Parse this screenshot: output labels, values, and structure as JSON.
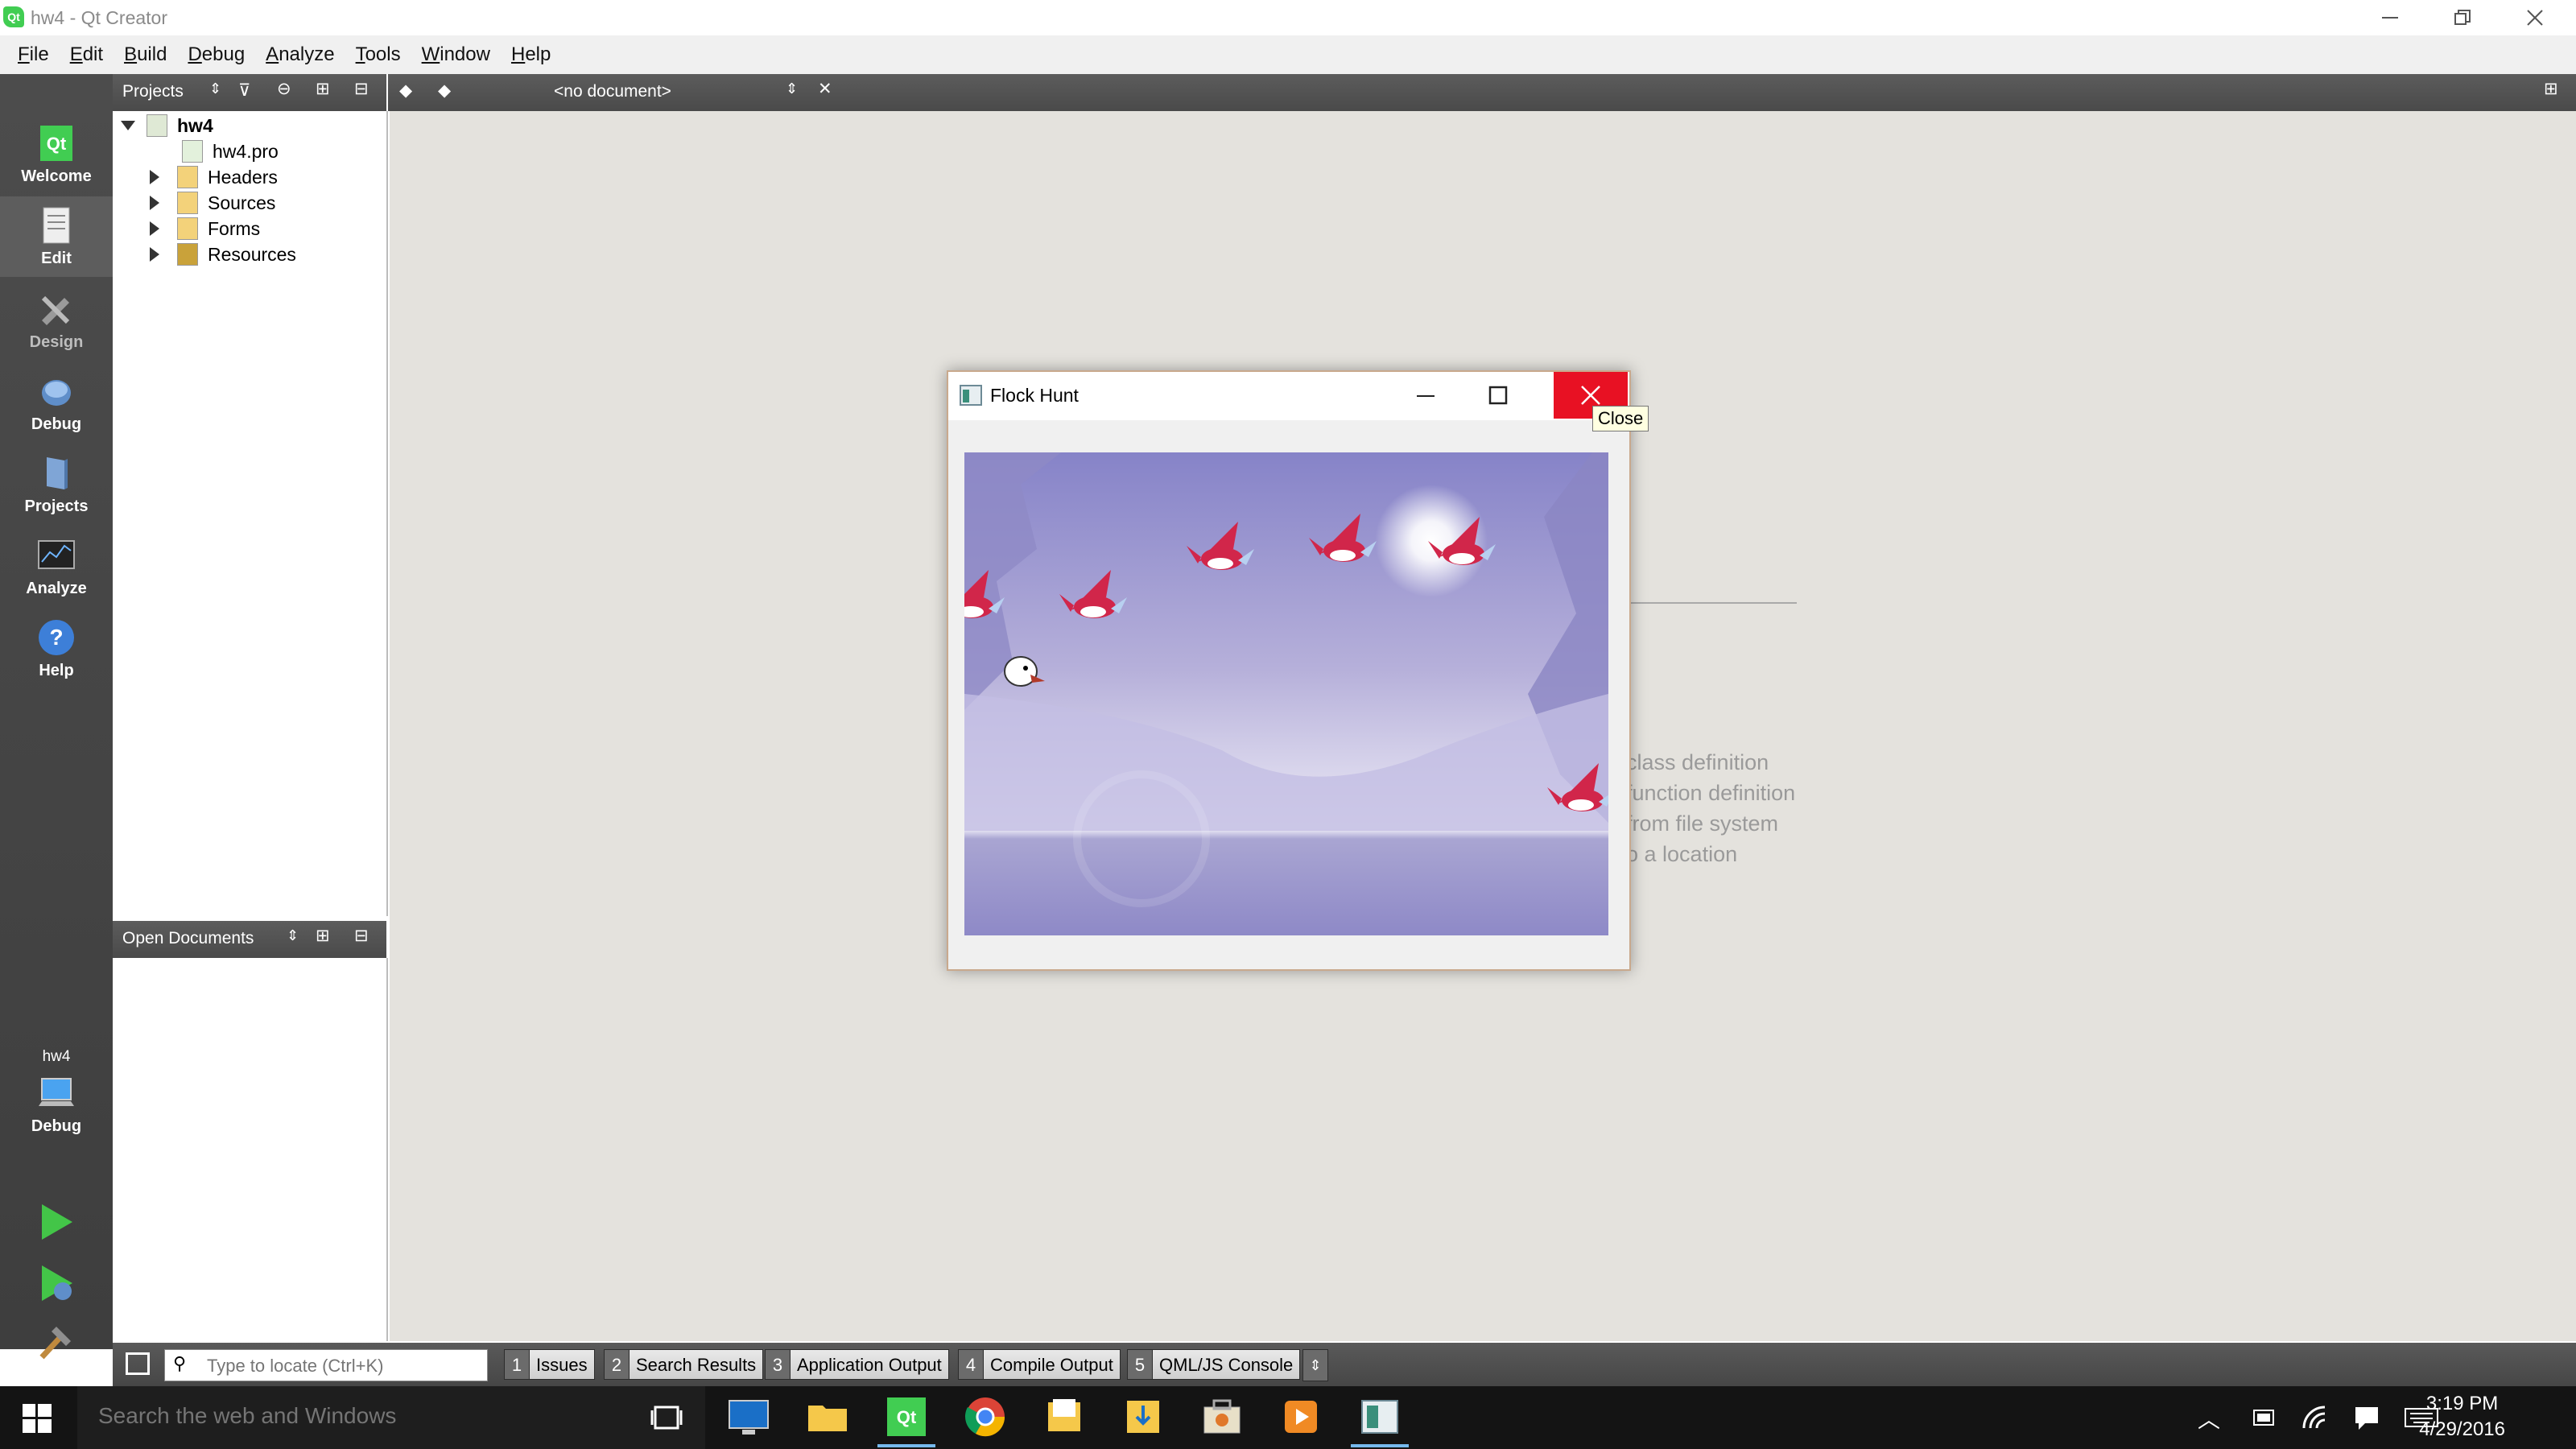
{
  "window": {
    "title": "hw4 - Qt Creator",
    "app_icon_text": "Qt"
  },
  "menubar": {
    "items": [
      "File",
      "Edit",
      "Build",
      "Debug",
      "Analyze",
      "Tools",
      "Window",
      "Help"
    ]
  },
  "modes": [
    {
      "label": "Welcome",
      "icon": "qt-logo-icon"
    },
    {
      "label": "Edit",
      "icon": "document-edit-icon"
    },
    {
      "label": "Design",
      "icon": "pencil-ruler-icon"
    },
    {
      "label": "Debug",
      "icon": "bug-icon"
    },
    {
      "label": "Projects",
      "icon": "wrench-folder-icon"
    },
    {
      "label": "Analyze",
      "icon": "monitor-graph-icon"
    },
    {
      "label": "Help",
      "icon": "question-circle-icon"
    }
  ],
  "kit": {
    "project": "hw4",
    "build": "Debug"
  },
  "projects_pane": {
    "selector_label": "Projects",
    "tree": {
      "root": "hw4",
      "items": [
        "hw4.pro",
        "Headers",
        "Sources",
        "Forms",
        "Resources"
      ]
    }
  },
  "open_documents": {
    "label": "Open Documents"
  },
  "editor": {
    "document_selector": "<no document>",
    "hints": [
      "class definition",
      "function definition",
      "from file system",
      "o a location"
    ]
  },
  "flock_window": {
    "title": "Flock Hunt",
    "tooltip": "Close"
  },
  "locator": {
    "placeholder": "Type to locate (Ctrl+K)"
  },
  "output_tabs": [
    {
      "num": "1",
      "label": "Issues"
    },
    {
      "num": "2",
      "label": "Search Results"
    },
    {
      "num": "3",
      "label": "Application Output"
    },
    {
      "num": "4",
      "label": "Compile Output"
    },
    {
      "num": "5",
      "label": "QML/JS Console"
    }
  ],
  "taskbar": {
    "search_placeholder": "Search the web and Windows",
    "time": "3:19 PM",
    "date": "4/29/2016"
  },
  "colors": {
    "qt_green": "#41cd52",
    "close_red": "#e81123",
    "bird_red": "#d1264a"
  }
}
